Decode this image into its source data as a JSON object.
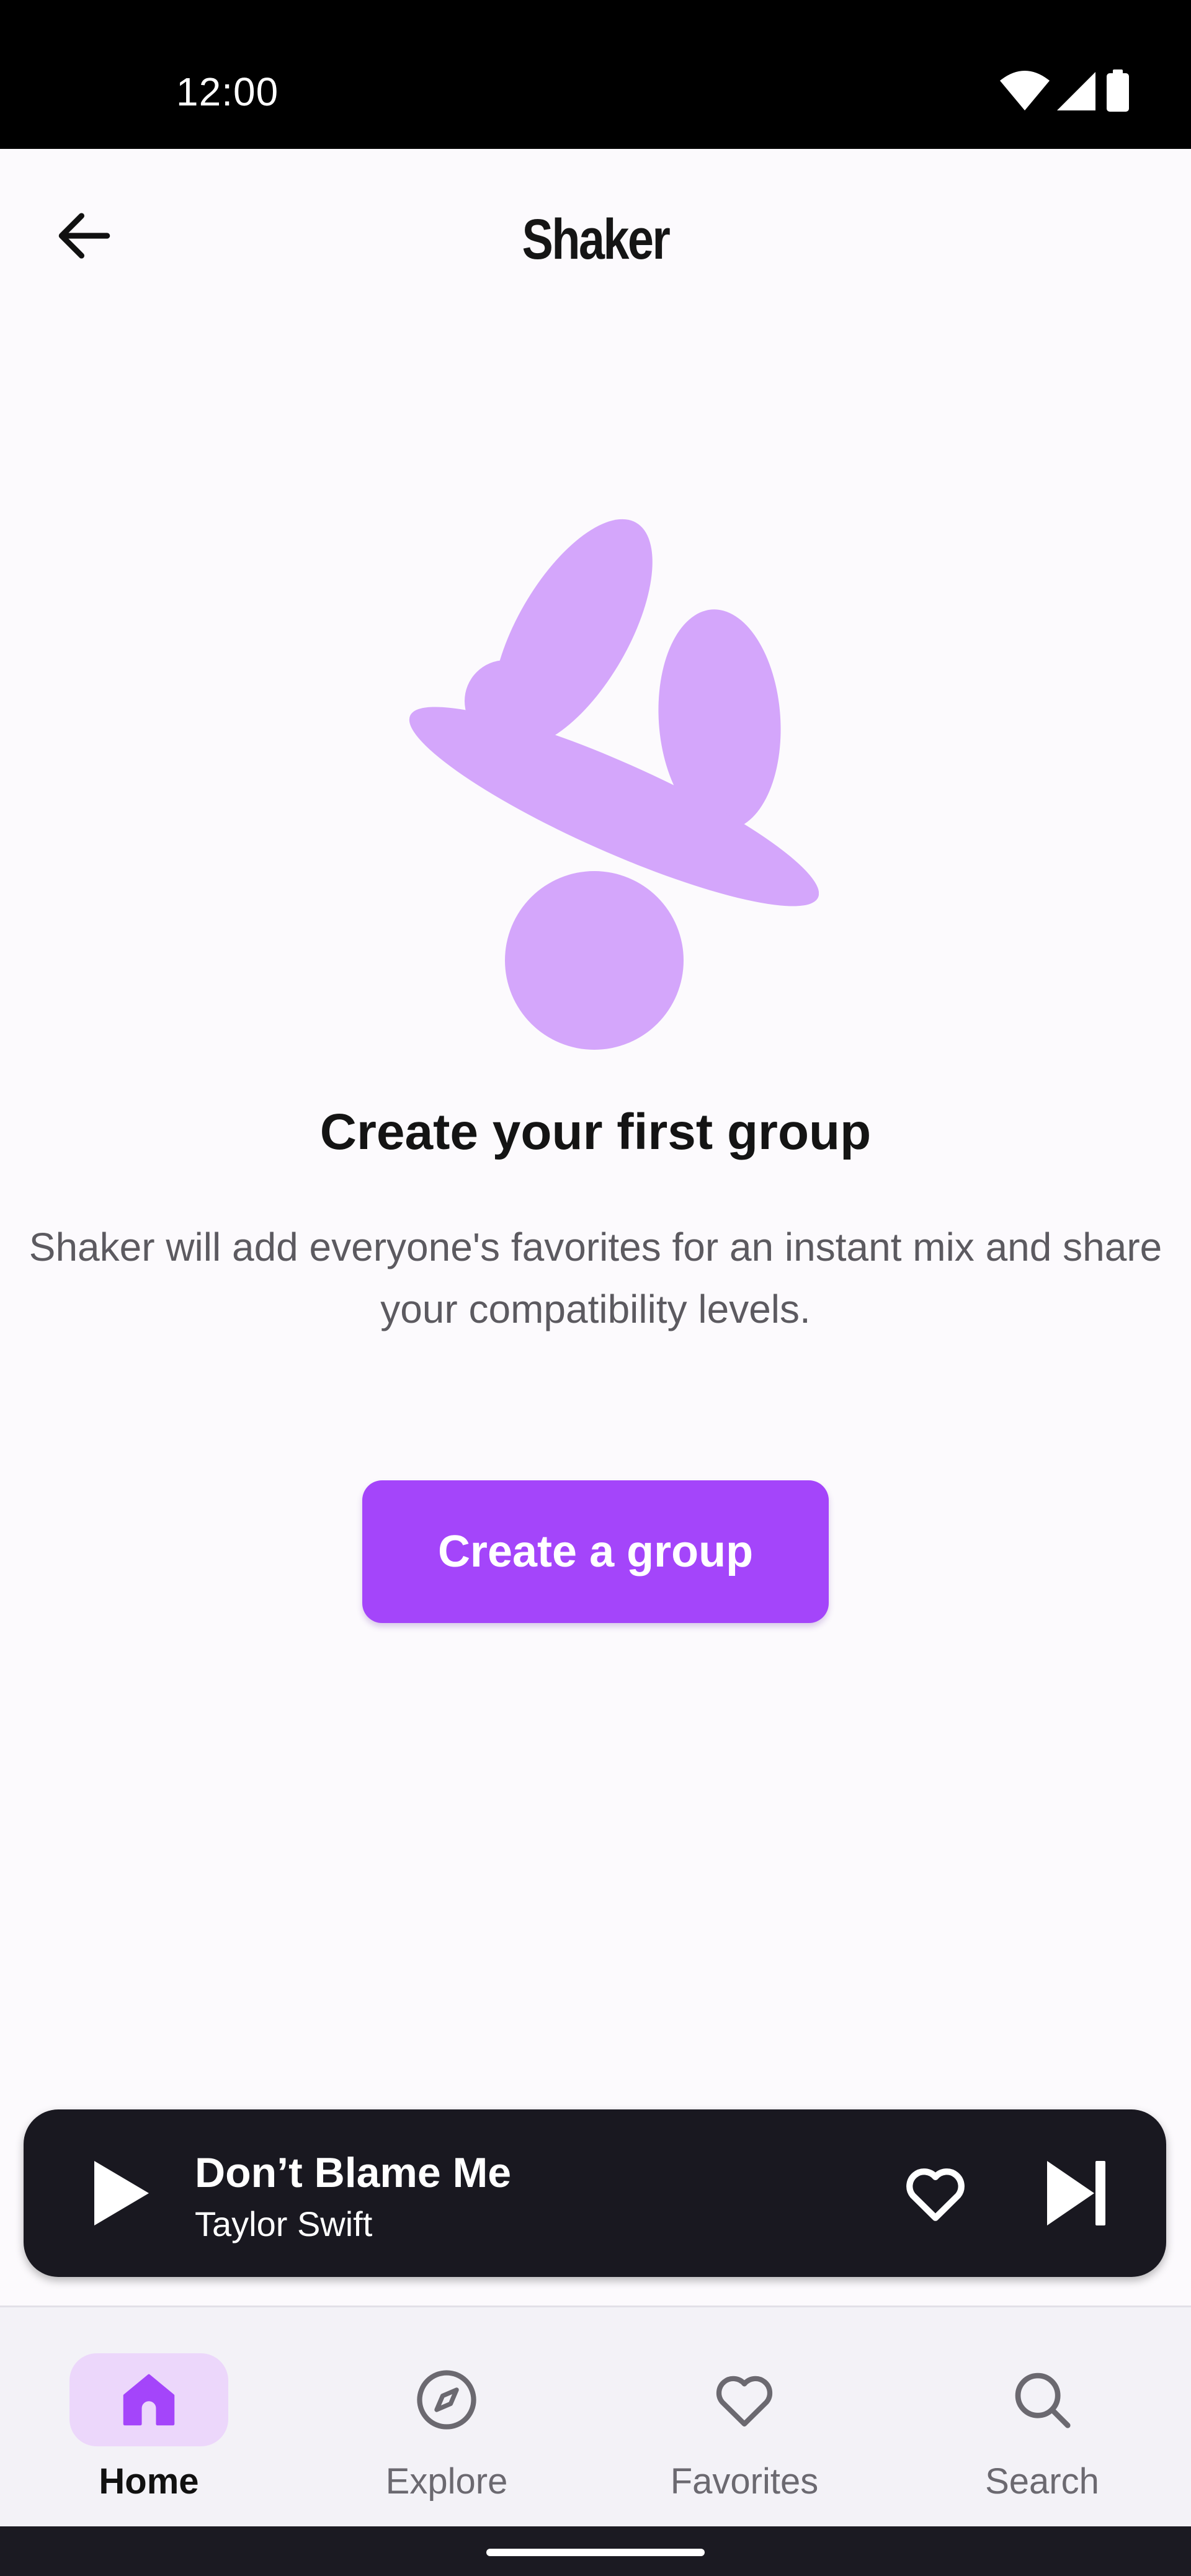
{
  "status_bar": {
    "time": "12:00",
    "icons": [
      "wifi-icon",
      "cellular-signal-icon",
      "battery-icon"
    ]
  },
  "app_bar": {
    "title": "Shaker",
    "back_icon": "arrow-left-icon"
  },
  "empty_state": {
    "illustration": "abstract-shapes-illustration",
    "title": "Create your first group",
    "body": "Shaker will add everyone's favorites for an instant mix and share your compatibility levels.",
    "button_label": "Create a group"
  },
  "mini_player": {
    "track_title": "Don’t Blame Me",
    "artist": "Taylor Swift",
    "play_icon": "play-icon",
    "like_icon": "heart-outline-icon",
    "next_icon": "skip-next-icon"
  },
  "bottom_nav": {
    "items": [
      {
        "label": "Home",
        "icon": "home-icon",
        "active": true
      },
      {
        "label": "Explore",
        "icon": "compass-icon",
        "active": false
      },
      {
        "label": "Favorites",
        "icon": "heart-icon",
        "active": false
      },
      {
        "label": "Search",
        "icon": "search-icon",
        "active": false
      }
    ]
  },
  "colors": {
    "background": "#fcfafd",
    "accent": "#a445fa",
    "illustration": "#d4a6fb",
    "nav_active_pill": "#ecd7fb",
    "player_background": "#191820"
  }
}
